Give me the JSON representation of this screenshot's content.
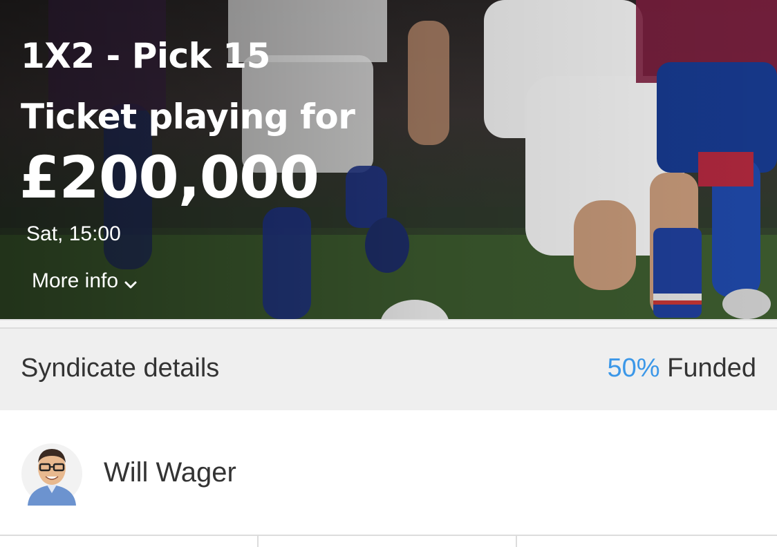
{
  "hero": {
    "title": "1X2 - Pick 15",
    "subtitle": "Ticket playing for",
    "prize": "£200,000",
    "kickoff": "Sat, 15:00",
    "more_info_label": "More info"
  },
  "syndicate": {
    "label": "Syndicate details",
    "funded_percent": "50%",
    "funded_label": " Funded",
    "accent_color": "#3b97e8"
  },
  "member": {
    "name": "Will Wager"
  },
  "icons": {
    "more_info": "chevron-down-icon",
    "avatar": "cartoon-avatar"
  }
}
